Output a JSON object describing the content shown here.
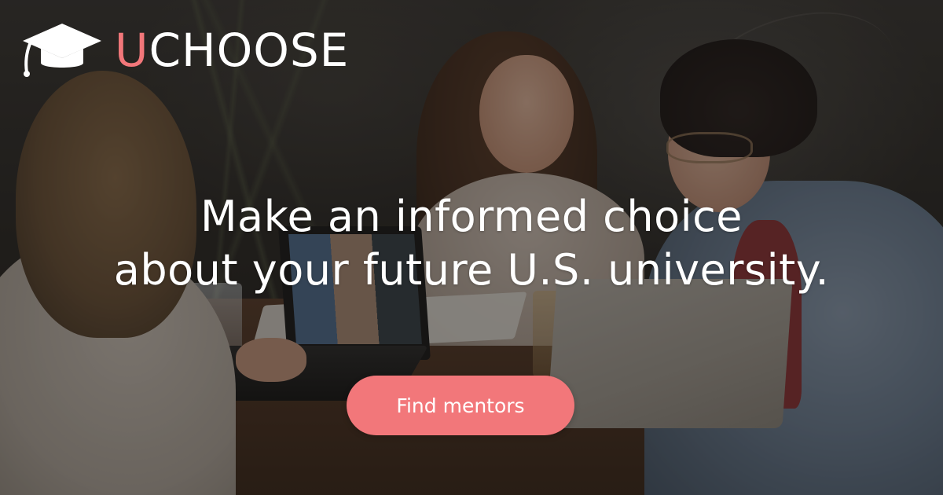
{
  "brand": {
    "logo_icon": "graduation-cap-icon",
    "name_accent": "U",
    "name_rest": "CHOOSE",
    "accent_color": "#f2777a"
  },
  "headline": {
    "line1": "Make an informed choice",
    "line2": "about your future U.S. university."
  },
  "cta": {
    "label": "Find mentors",
    "color": "#f2777a"
  }
}
